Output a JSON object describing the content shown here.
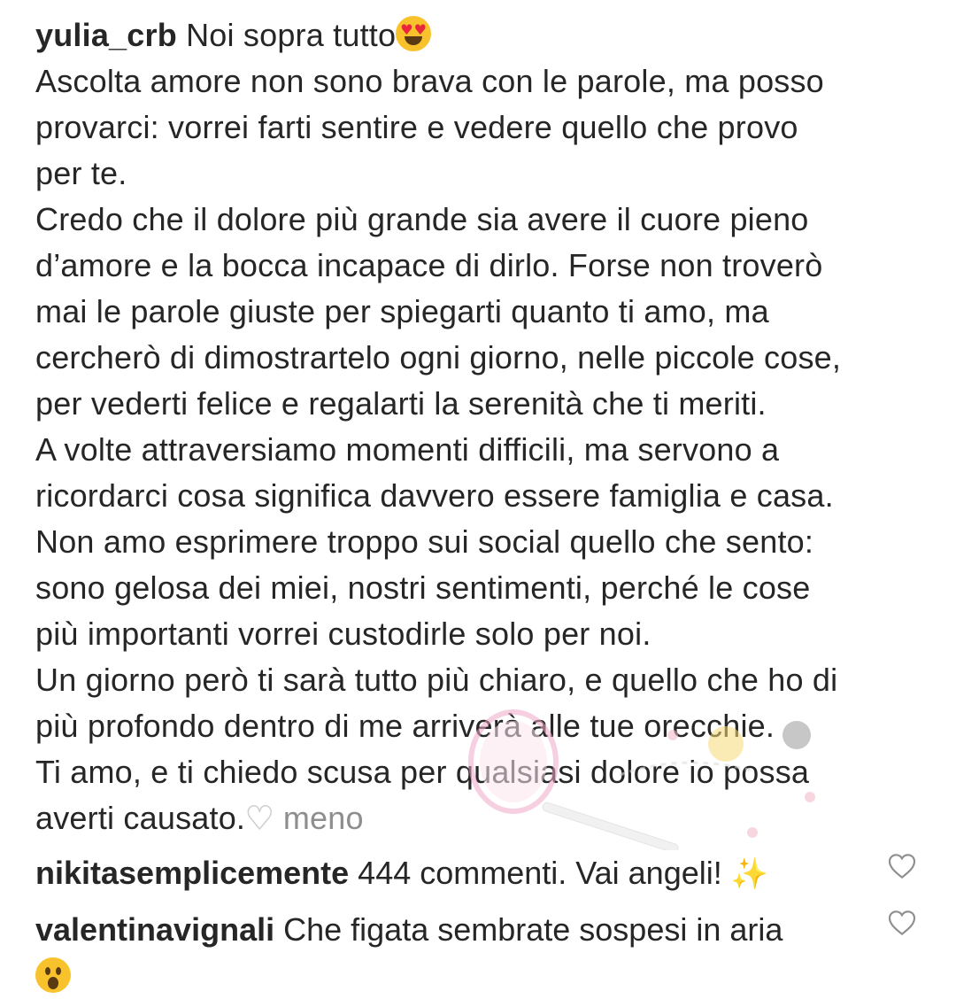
{
  "caption": {
    "username": "yulia_crb",
    "first_line_text": "Noi sopra tutto",
    "lines": [
      "Ascolta amore non sono brava con le parole, ma posso",
      "provarci: vorrei farti sentire e vedere quello che provo",
      "per te.",
      "Credo che il dolore più grande sia avere il cuore pieno",
      "d’amore e la bocca incapace di dirlo. Forse non troverò",
      "mai le parole giuste per spiegarti quanto ti amo, ma",
      "cercherò di dimostrartelo ogni giorno, nelle piccole cose,",
      "per vederti felice e regalarti la serenità che ti meriti.",
      "A volte attraversiamo momenti difficili, ma servono a",
      "ricordarci cosa significa davvero essere famiglia e casa.",
      "Non amo esprimere troppo sui social quello che sento:",
      "sono gelosa dei miei, nostri sentimenti, perché le cose",
      "più importanti vorrei custodirle solo per noi.",
      "Un giorno però ti sarà tutto più chiaro, e quello che ho di",
      "più profondo dentro di me arriverà alle tue orecchie.",
      "Ti amo, e ti chiedo scusa per qualsiasi dolore io possa"
    ],
    "last_line_text": "averti causato.",
    "more_label": "meno"
  },
  "comments": [
    {
      "username": "nikitasemplicemente",
      "text": "444 commenti. Vai angeli!",
      "emoji": "sparkles"
    },
    {
      "username": "valentinavignali",
      "text": "Che figata sembrate sospesi in aria",
      "emoji": "astonished-face"
    }
  ],
  "icons": {
    "like": "heart-outline-icon"
  },
  "colors": {
    "text": "#262626",
    "secondary": "#8e8e8e"
  }
}
